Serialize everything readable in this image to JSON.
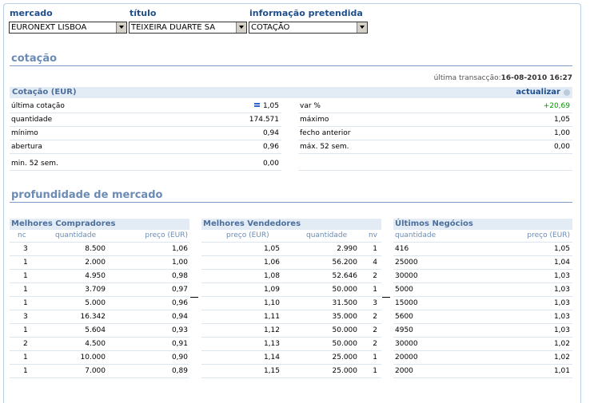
{
  "selectors": [
    {
      "label": "mercado",
      "value": "EURONEXT LISBOA"
    },
    {
      "label": "título",
      "value": "TEIXEIRA DUARTE SA"
    },
    {
      "label": "informação pretendida",
      "value": "COTAÇÃO"
    }
  ],
  "quote_section": {
    "title": "cotação",
    "last_trade_label": "última transacção:",
    "last_trade_value": "16-08-2010 16:27",
    "header": "Cotação (EUR)",
    "refresh": "actualizar",
    "left_rows": [
      {
        "label": "última cotação",
        "value": "1,05"
      },
      {
        "label": "quantidade",
        "value": "174.571"
      },
      {
        "label": "mínimo",
        "value": "0,94"
      },
      {
        "label": "abertura",
        "value": "0,96"
      },
      {
        "label": "min. 52 sem.",
        "value": "0,00"
      }
    ],
    "right_rows": [
      {
        "label": "var %",
        "value": "+20,69"
      },
      {
        "label": "máximo",
        "value": "1,05"
      },
      {
        "label": "fecho anterior",
        "value": "1,00"
      },
      {
        "label": "máx. 52 sem.",
        "value": "0,00"
      }
    ]
  },
  "depth_section": {
    "title": "profundidade de mercado",
    "buyers": {
      "title": "Melhores Compradores",
      "columns": [
        "nc",
        "quantidade",
        "preço (EUR)"
      ],
      "rows": [
        [
          "3",
          "8.500",
          "1,06"
        ],
        [
          "1",
          "2.000",
          "1,00"
        ],
        [
          "1",
          "4.950",
          "0,98"
        ],
        [
          "1",
          "3.709",
          "0,97"
        ],
        [
          "1",
          "5.000",
          "0,96"
        ],
        [
          "3",
          "16.342",
          "0,94"
        ],
        [
          "1",
          "5.604",
          "0,93"
        ],
        [
          "2",
          "4.500",
          "0,91"
        ],
        [
          "1",
          "10.000",
          "0,90"
        ],
        [
          "1",
          "7.000",
          "0,89"
        ]
      ]
    },
    "sellers": {
      "title": "Melhores Vendedores",
      "columns": [
        "preço (EUR)",
        "quantidade",
        "nv"
      ],
      "rows": [
        [
          "1,05",
          "2.990",
          "1"
        ],
        [
          "1,06",
          "56.200",
          "4"
        ],
        [
          "1,08",
          "52.646",
          "2"
        ],
        [
          "1,09",
          "50.000",
          "1"
        ],
        [
          "1,10",
          "31.500",
          "3"
        ],
        [
          "1,11",
          "35.000",
          "2"
        ],
        [
          "1,12",
          "50.000",
          "2"
        ],
        [
          "1,13",
          "50.000",
          "2"
        ],
        [
          "1,14",
          "25.000",
          "1"
        ],
        [
          "1,15",
          "25.000",
          "1"
        ]
      ]
    },
    "trades": {
      "title": "Últimos Negócios",
      "columns": [
        "quantidade",
        "preço (EUR)"
      ],
      "rows": [
        [
          "416",
          "1,05"
        ],
        [
          "25000",
          "1,04"
        ],
        [
          "30000",
          "1,03"
        ],
        [
          "5000",
          "1,03"
        ],
        [
          "15000",
          "1,03"
        ],
        [
          "5600",
          "1,03"
        ],
        [
          "4950",
          "1,03"
        ],
        [
          "30000",
          "1,02"
        ],
        [
          "20000",
          "1,02"
        ],
        [
          "2000",
          "1,01"
        ]
      ]
    }
  }
}
